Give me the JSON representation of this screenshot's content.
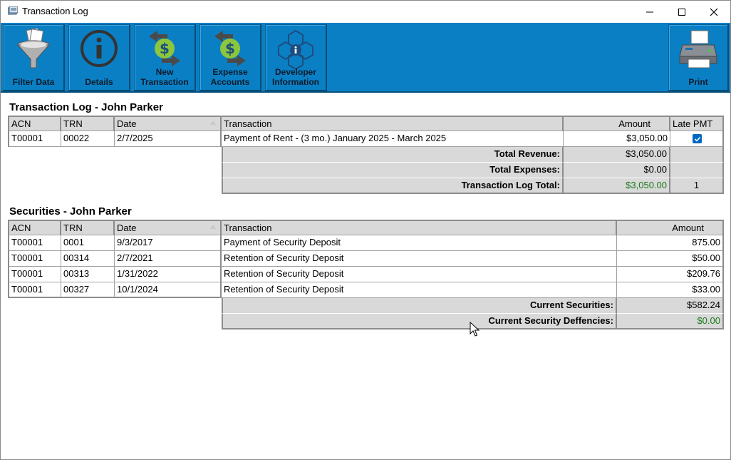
{
  "window": {
    "title": "Transaction Log"
  },
  "toolbar": {
    "buttons": [
      {
        "label": "Filter Data",
        "icon": "funnel-icon"
      },
      {
        "label": "Details",
        "icon": "info-icon"
      },
      {
        "label_line1": "New",
        "label_line2": "Transaction",
        "icon": "dollar-exchange-icon"
      },
      {
        "label_line1": "Expense",
        "label_line2": "Accounts",
        "icon": "dollar-exchange-icon"
      },
      {
        "label_line1": "Developer",
        "label_line2": "Information",
        "icon": "network-info-icon"
      },
      {
        "label": "Print",
        "icon": "printer-icon"
      }
    ]
  },
  "transaction_log": {
    "title": "Transaction Log - John Parker",
    "columns": [
      "ACN",
      "TRN",
      "Date",
      "Transaction",
      "Amount",
      "Late PMT"
    ],
    "rows": [
      {
        "acn": "T00001",
        "trn": "00022",
        "date": "2/7/2025",
        "transaction": "Payment of Rent - (3 mo.) January 2025 - March 2025",
        "amount": "$3,050.00",
        "late_pmt": true
      }
    ],
    "summary": {
      "total_revenue_label": "Total Revenue:",
      "total_revenue": "$3,050.00",
      "total_expenses_label": "Total Expenses:",
      "total_expenses": "$0.00",
      "log_total_label": "Transaction Log Total:",
      "log_total": "$3,050.00",
      "late_count": "1"
    }
  },
  "securities": {
    "title": "Securities - John Parker",
    "columns": [
      "ACN",
      "TRN",
      "Date",
      "Transaction",
      "Amount"
    ],
    "rows": [
      {
        "acn": "T00001",
        "trn": "0001",
        "date": "9/3/2017",
        "transaction": "Payment of Security Deposit",
        "amount": "875.00"
      },
      {
        "acn": "T00001",
        "trn": "00314",
        "date": "2/7/2021",
        "transaction": "Retention of Security Deposit",
        "amount": "$50.00"
      },
      {
        "acn": "T00001",
        "trn": "00313",
        "date": "1/31/2022",
        "transaction": "Retention of Security Deposit",
        "amount": "$209.76"
      },
      {
        "acn": "T00001",
        "trn": "00327",
        "date": "10/1/2024",
        "transaction": "Retention of Security Deposit",
        "amount": "$33.00"
      }
    ],
    "summary": {
      "current_label": "Current Securities:",
      "current": "$582.24",
      "deficiency_label": "Current Security Deffencies:",
      "deficiency": "$0.00"
    }
  },
  "colors": {
    "toolbar_blue": "#0b7fc4",
    "positive_green": "#1a7a1a",
    "checkbox_blue": "#0067c0"
  }
}
